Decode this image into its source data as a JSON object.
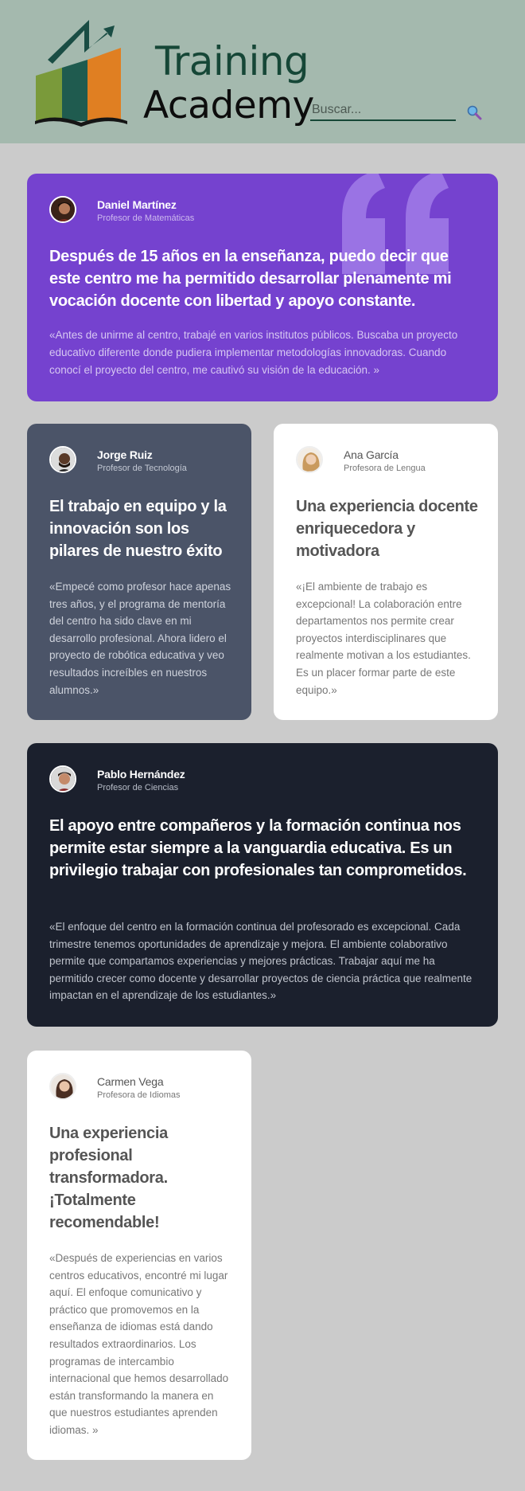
{
  "header": {
    "logo_line1": "Training",
    "logo_line2": "Academy",
    "search_placeholder": "Buscar...",
    "search_icon": "search-icon"
  },
  "testimonials": [
    {
      "name": "Daniel Martínez",
      "role": "Profesor de Matemáticas",
      "headline": "Después de 15 años en la enseñanza, puedo decir que este centro me ha permitido desarrollar plenamente mi vocación docente con libertad y apoyo constante.",
      "quote": "«Antes de unirme al centro, trabajé en varios institutos públicos. Buscaba un proyecto educativo diferente donde pudiera implementar metodologías innovadoras. Cuando conocí el proyecto del centro, me cautivó su visión de la educación. »",
      "color": "#7542cf"
    },
    {
      "name": "Jorge Ruiz",
      "role": "Profesor de Tecnología",
      "headline": "El trabajo en equipo y la innovación son los pilares de nuestro éxito",
      "quote": "«Empecé como profesor hace apenas tres años, y el programa de mentoría del centro ha sido clave en mi desarrollo profesional. Ahora lidero el proyecto de robótica educativa y veo resultados increíbles en nuestros alumnos.»",
      "color": "#4b5468"
    },
    {
      "name": "Ana García",
      "role": "Profesora de Lengua",
      "headline": "Una experiencia docente enriquecedora y motivadora",
      "quote": "«¡El ambiente de trabajo es excepcional! La colaboración entre departamentos nos permite crear proyectos interdisciplinares que realmente motivan a los estudiantes. Es un placer formar parte de este equipo.»",
      "color": "#ffffff"
    },
    {
      "name": "Pablo Hernández",
      "role": "Profesor de Ciencias",
      "headline": "El apoyo entre compañeros y la formación continua nos permite estar siempre a la vanguardia educativa. Es un privilegio trabajar con profesionales tan comprometidos.",
      "quote": "«El enfoque del centro en la formación continua del profesorado es excepcional. Cada trimestre tenemos oportunidades de aprendizaje y mejora. El ambiente colaborativo permite que compartamos experiencias y mejores prácticas. Trabajar aquí me ha permitido crecer como docente y desarrollar proyectos de ciencia práctica que realmente impactan en el aprendizaje de los estudiantes.»",
      "color": "#1b202d"
    },
    {
      "name": "Carmen Vega",
      "role": "Profesora de Idiomas",
      "headline": "Una experiencia profesional transformadora. ¡Totalmente recomendable!",
      "quote": "«Después de experiencias en varios centros educativos, encontré mi lugar aquí. El enfoque comunicativo y práctico que promovemos en la enseñanza de idiomas está dando resultados extraordinarios. Los programas de intercambio internacional que hemos desarrollado están transformando la manera en que nuestros estudiantes aprenden idiomas. »",
      "color": "#ffffff"
    }
  ]
}
